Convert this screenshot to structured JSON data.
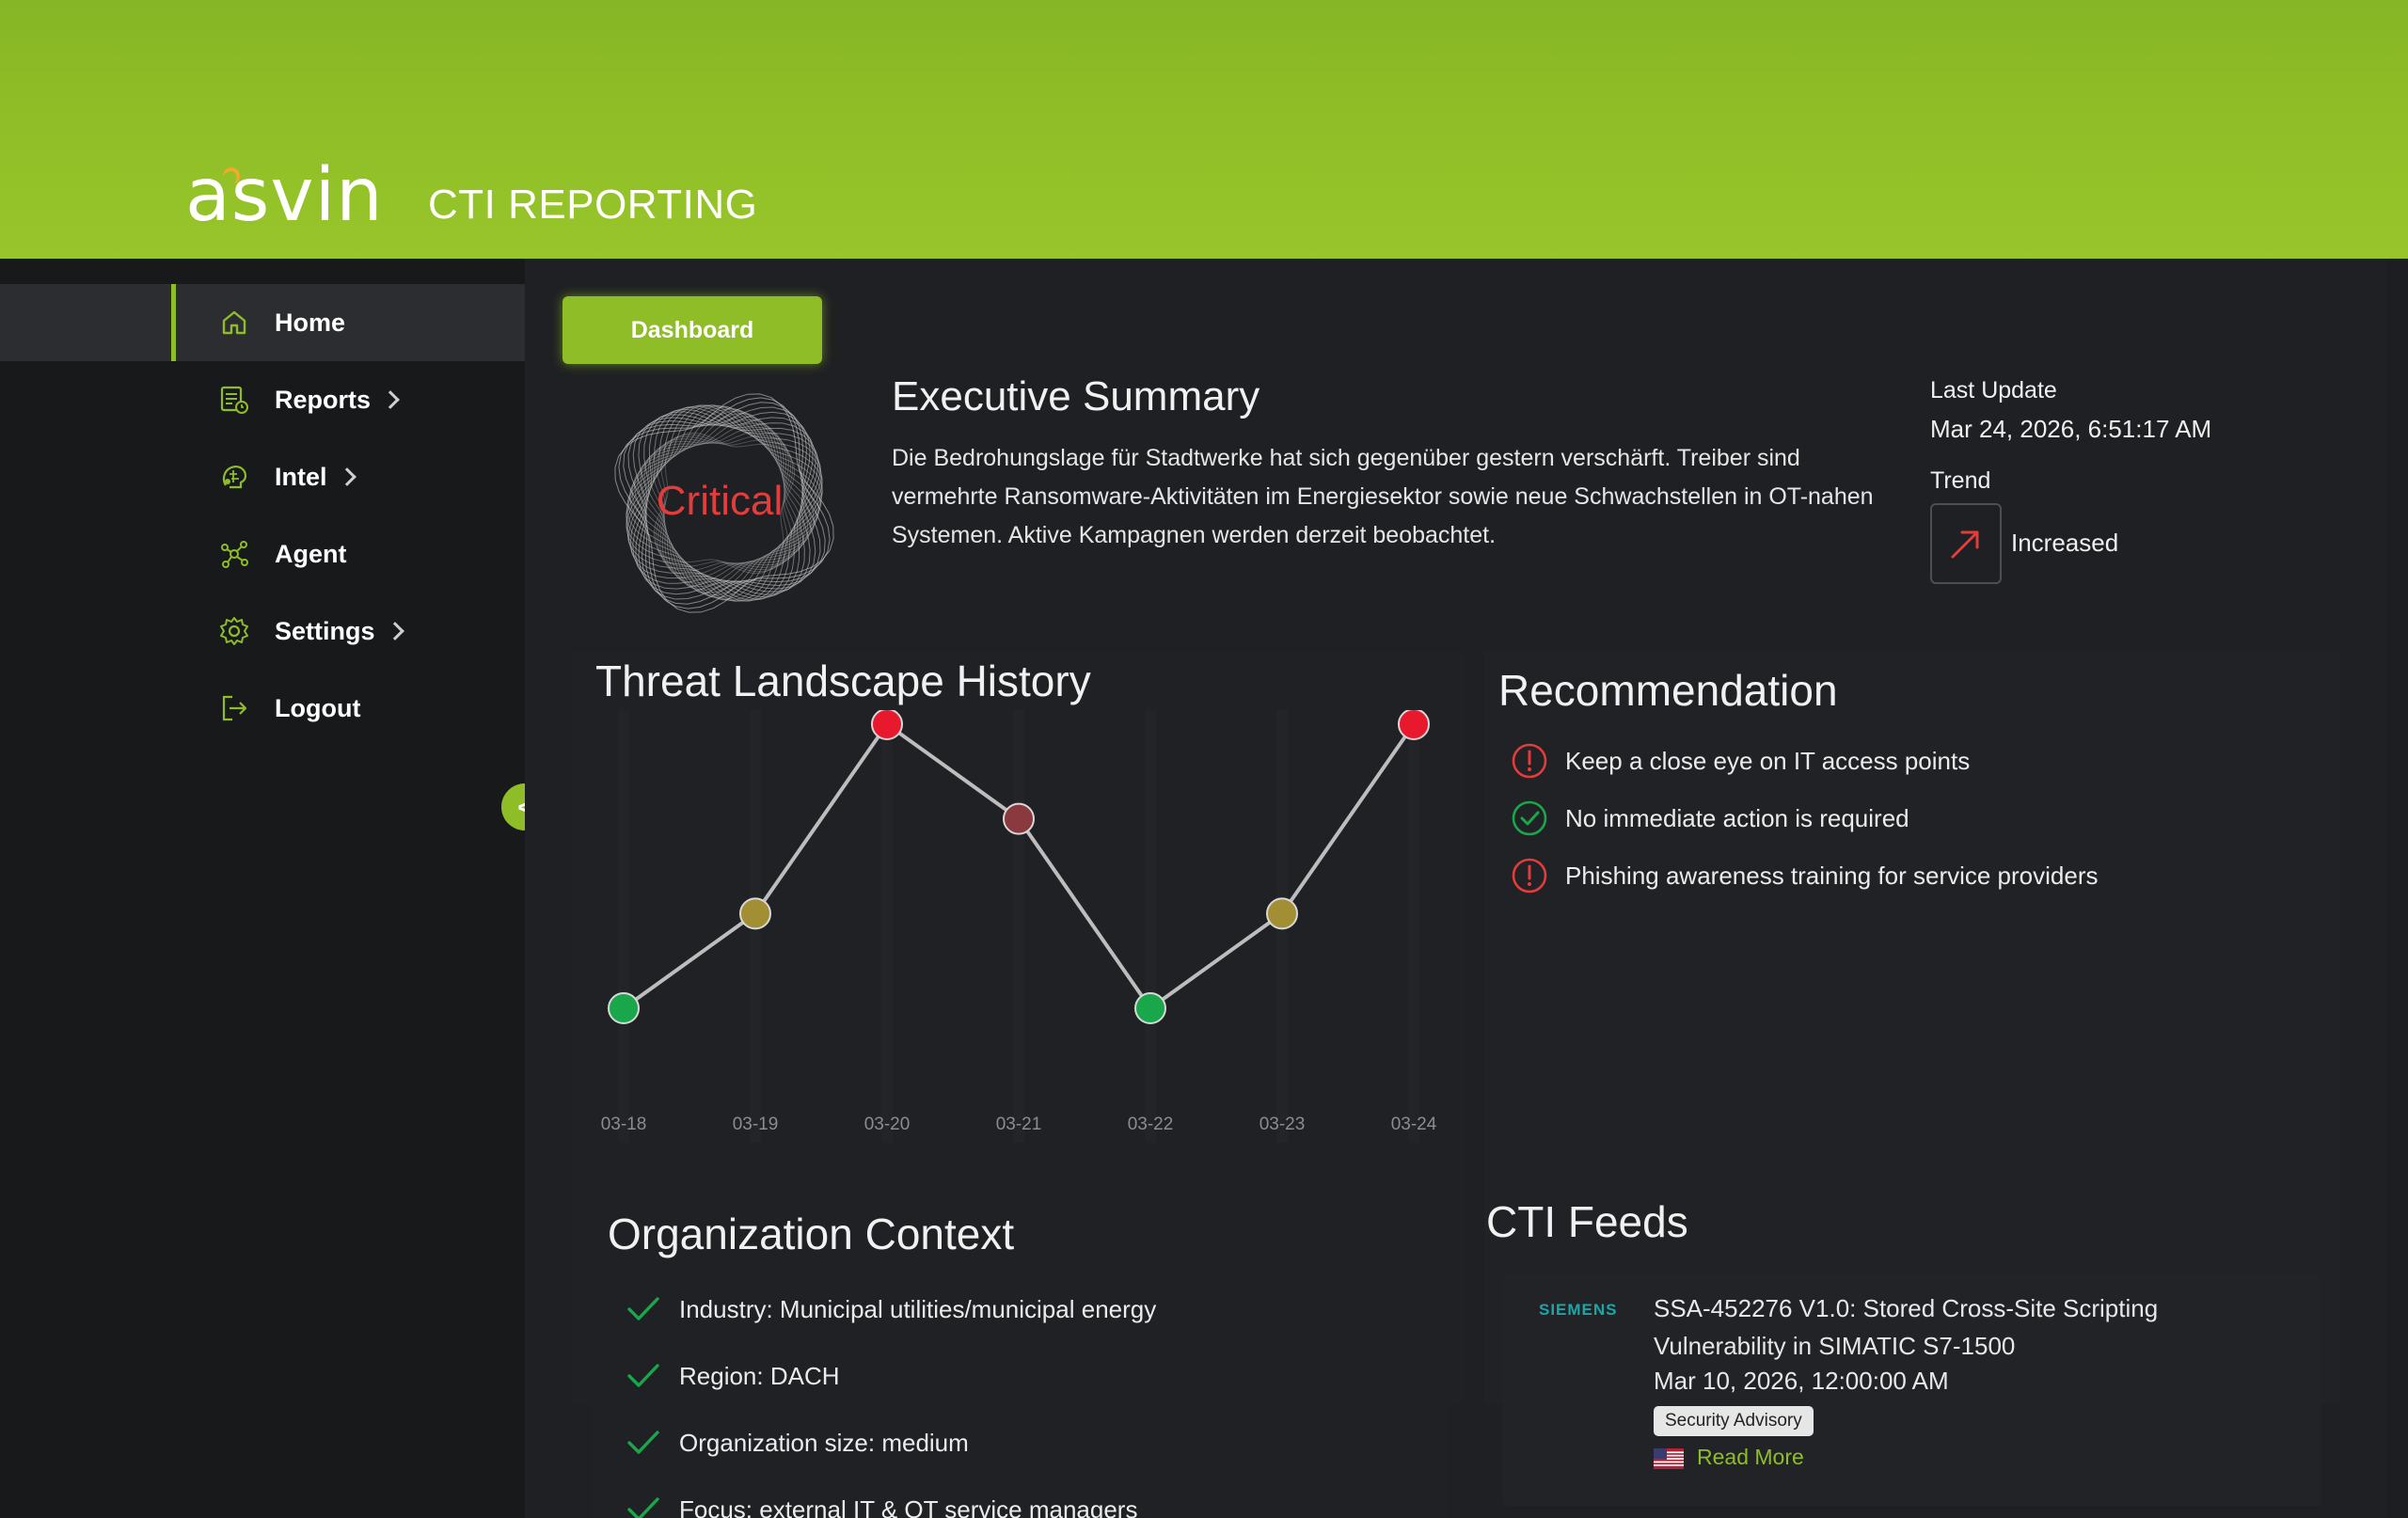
{
  "header": {
    "logo": "asvin",
    "title": "CTI REPORTING"
  },
  "sidebar": {
    "items": [
      {
        "label": "Home",
        "icon": "home-icon",
        "active": true,
        "has_submenu": false
      },
      {
        "label": "Reports",
        "icon": "reports-icon",
        "active": false,
        "has_submenu": true
      },
      {
        "label": "Intel",
        "icon": "intel-icon",
        "active": false,
        "has_submenu": true
      },
      {
        "label": "Agent",
        "icon": "agent-icon",
        "active": false,
        "has_submenu": false
      },
      {
        "label": "Settings",
        "icon": "gear-icon",
        "active": false,
        "has_submenu": true
      },
      {
        "label": "Logout",
        "icon": "logout-icon",
        "active": false,
        "has_submenu": false
      }
    ],
    "collapse_label": "<"
  },
  "tabs": {
    "dashboard": "Dashboard"
  },
  "summary": {
    "level": "Critical",
    "title": "Executive Summary",
    "body": "Die Bedrohungslage für Stadtwerke hat sich gegenüber gestern verschärft. Treiber sind vermehrte Ransomware-Aktivitäten im Energiesektor sowie neue Schwachstellen in OT-nahen Systemen. Aktive Kampagnen werden derzeit beobachtet.",
    "last_update_label": "Last Update",
    "last_update_value": "Mar 24, 2026, 6:51:17 AM",
    "trend_label": "Trend",
    "trend_value": "Increased"
  },
  "chart_title": "Threat Landscape History",
  "chart_data": {
    "type": "line",
    "title": "Threat Landscape History",
    "categories": [
      "03-18",
      "03-19",
      "03-20",
      "03-21",
      "03-22",
      "03-23",
      "03-24"
    ],
    "values": [
      1,
      2,
      4,
      3,
      1,
      2,
      4
    ],
    "point_levels": [
      "low",
      "medium",
      "critical",
      "high",
      "low",
      "medium",
      "critical"
    ],
    "level_colors": {
      "low": "#1aa64a",
      "medium": "#a38f33",
      "high": "#8a3a3f",
      "critical": "#e8192c"
    },
    "ylim": [
      0,
      4.5
    ],
    "grid": false
  },
  "recommendation": {
    "title": "Recommendation",
    "items": [
      {
        "text": "Keep a close eye on IT access points",
        "status": "warning"
      },
      {
        "text": "No immediate action is required",
        "status": "ok"
      },
      {
        "text": "Phishing awareness training for service providers",
        "status": "warning"
      }
    ]
  },
  "org_context": {
    "title": "Organization Context",
    "items": [
      "Industry: Municipal utilities/municipal energy",
      "Region: DACH",
      "Organization size: medium",
      "Focus: external IT & OT service managers"
    ]
  },
  "cti_feeds": {
    "title": "CTI Feeds",
    "items": [
      {
        "vendor": "SIEMENS",
        "headline": "SSA-452276 V1.0: Stored Cross-Site Scripting Vulnerability in SIMATIC S7-1500",
        "date": "Mar 10, 2026, 12:00:00 AM",
        "tag": "Security Advisory",
        "link": "Read More",
        "flag": "us-flag-icon"
      }
    ]
  },
  "colors": {
    "accent": "#8fbd27",
    "critical": "#e23c3c",
    "ok": "#1aa64a",
    "siemens": "#1ca6a6"
  }
}
